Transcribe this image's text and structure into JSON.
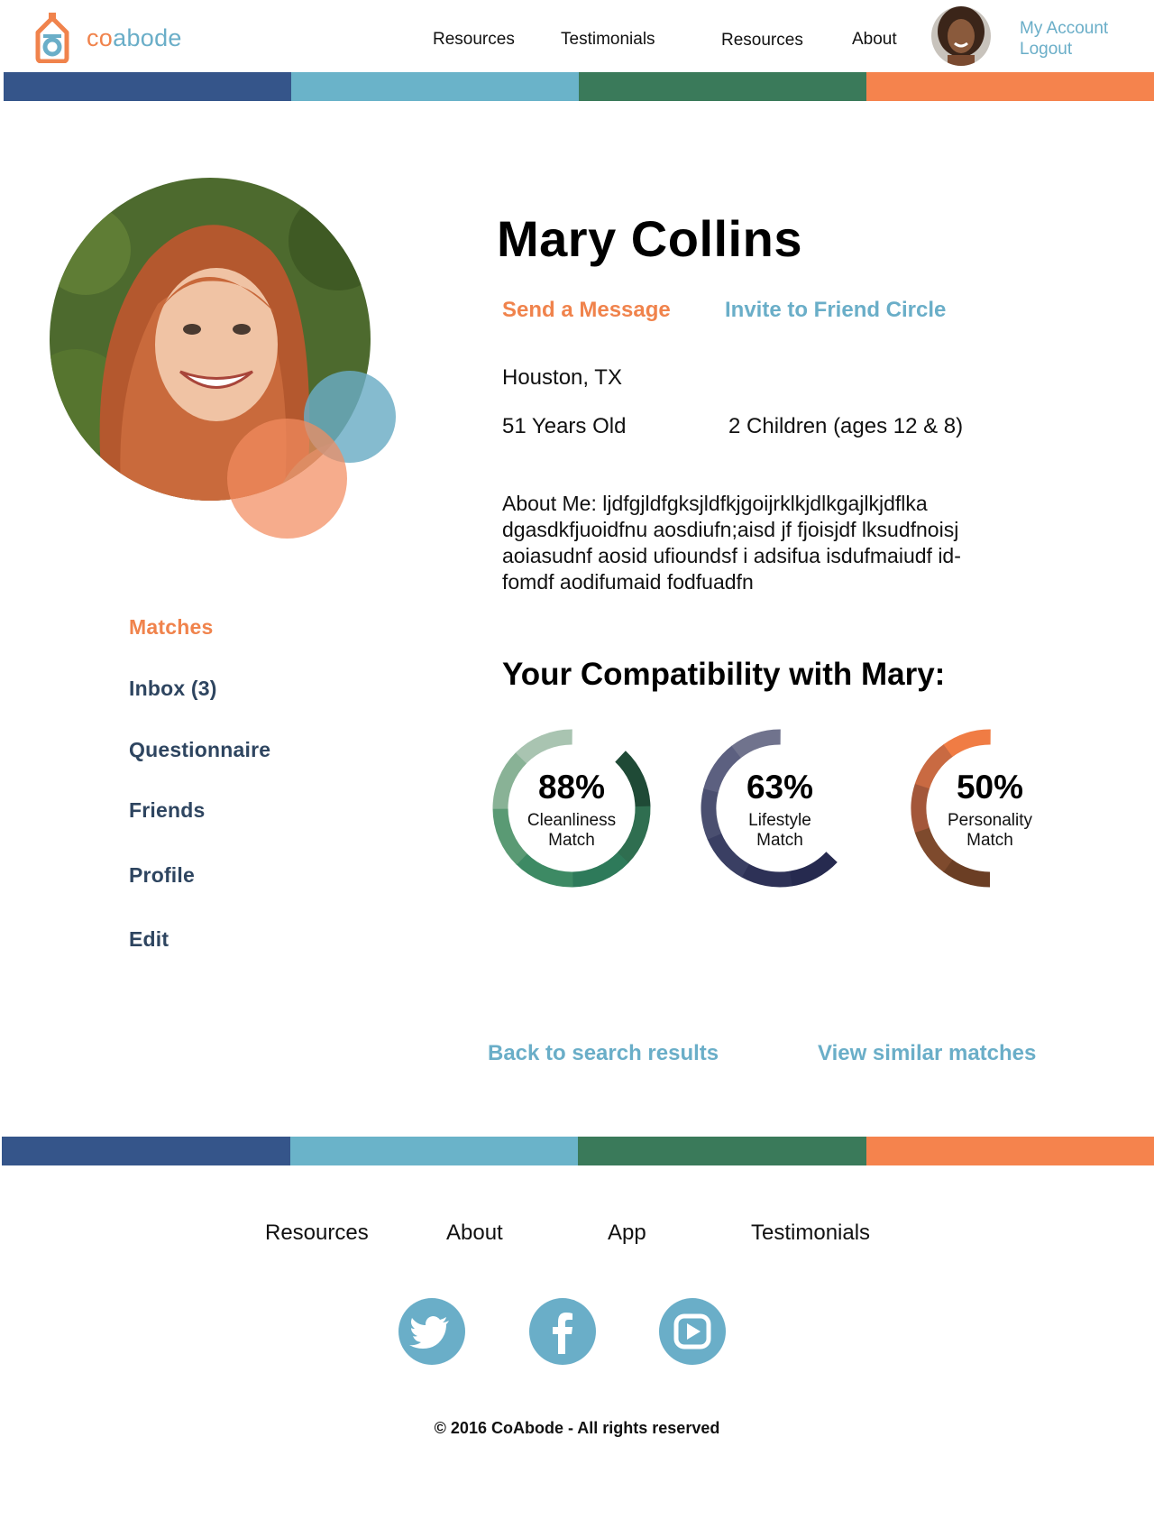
{
  "brand": {
    "co": "co",
    "abode": "abode"
  },
  "nav": {
    "items": [
      {
        "label": "Resources"
      },
      {
        "label": "Testimonials"
      },
      {
        "label": "Resources"
      },
      {
        "label": "About"
      }
    ],
    "my_account": "My Account",
    "logout": "Logout"
  },
  "stripe_colors": [
    "#35558a",
    "#6ab3c9",
    "#3a7a5a",
    "#f5834d"
  ],
  "profile": {
    "name": "Mary Collins",
    "send_message": "Send a Message",
    "invite": "Invite to Friend Circle",
    "location": "Houston, TX",
    "age": "51 Years Old",
    "children": "2 Children (ages 12 & 8)",
    "about_lines": [
      "About Me: ljdfgjldfgksjldfkjgoijrklkjdlkgajlkjdflka",
      "dgasdkfjuoidfnu aosdiufn;aisd jf fjoisjdf lksudfnoisj",
      "aoiasudnf  aosid ufioundsf i adsifua isdufmaiudf id-",
      "fomdf aodifumaid fodfuadfn"
    ]
  },
  "sidebar": {
    "items": [
      {
        "label": "Matches",
        "active": true
      },
      {
        "label": "Inbox (3)"
      },
      {
        "label": "Questionnaire"
      },
      {
        "label": "Friends"
      },
      {
        "label": "Profile"
      },
      {
        "label": "Edit"
      }
    ]
  },
  "compatibility": {
    "title": "Your Compatibility with Mary:",
    "items": [
      {
        "pct_text": "88%",
        "value": 88,
        "label1": "Cleanliness",
        "label2": "Match",
        "colors": [
          "#1f4a36",
          "#2f6e50",
          "#2e7a5a",
          "#3d8a64",
          "#5a9a74",
          "#89b296",
          "#a9c4b1"
        ]
      },
      {
        "pct_text": "63%",
        "value": 63,
        "label1": "Lifestyle",
        "label2": "Match",
        "colors": [
          "#262a4f",
          "#2d3156",
          "#3a3f63",
          "#4a4f70",
          "#5c6080",
          "#70738d"
        ]
      },
      {
        "pct_text": "50%",
        "value": 50,
        "label1": "Personality",
        "label2": "Match",
        "colors": [
          "#6b3e24",
          "#7e4a2d",
          "#a3573a",
          "#c96a42",
          "#f07c44"
        ]
      }
    ]
  },
  "links": {
    "back": "Back to search results",
    "similar": "View similar matches"
  },
  "footer": {
    "links": [
      {
        "label": "Resources"
      },
      {
        "label": "About"
      },
      {
        "label": "App"
      },
      {
        "label": "Testimonials"
      }
    ],
    "social": [
      "twitter-icon",
      "facebook-icon",
      "youtube-icon"
    ],
    "copyright": "© 2016 CoAbode - All rights reserved"
  }
}
